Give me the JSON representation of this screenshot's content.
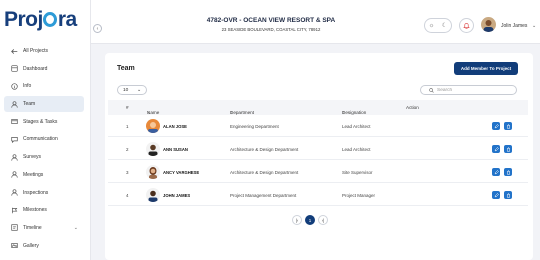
{
  "brand": {
    "logo_pre": "Proj",
    "logo_post": "ra"
  },
  "sidebar": {
    "items": [
      {
        "label": "All Projects",
        "icon": "arrow-left-icon"
      },
      {
        "label": "Dashboard",
        "icon": "dashboard-icon"
      },
      {
        "label": "Info",
        "icon": "info-icon"
      },
      {
        "label": "Team",
        "icon": "user-icon",
        "active": true
      },
      {
        "label": "Stages & Tasks",
        "icon": "tasks-icon"
      },
      {
        "label": "Communication",
        "icon": "chat-icon"
      },
      {
        "label": "Surveys",
        "icon": "survey-icon"
      },
      {
        "label": "Meetings",
        "icon": "meeting-icon"
      },
      {
        "label": "Inspections",
        "icon": "inspection-icon"
      },
      {
        "label": "Milestones",
        "icon": "milestone-icon"
      },
      {
        "label": "Timeline",
        "icon": "timeline-icon"
      },
      {
        "label": "Gallery",
        "icon": "gallery-icon"
      }
    ]
  },
  "header": {
    "project_title": "4782-OVR - OCEAN VIEW RESORT & SPA",
    "project_address": "23 SEASIDE BOULEVARD, COASTAL CITY, 78912",
    "user_name": "Jolin James"
  },
  "team": {
    "title": "Team",
    "add_button": "Add Member To Project",
    "page_size": "10",
    "search_placeholder": "Search",
    "columns": {
      "num": "#",
      "name": "Name",
      "department": "Department",
      "designation": "Designation",
      "action": "Action"
    },
    "rows": [
      {
        "num": "1",
        "name": "ALAN JOSE",
        "department": "Engineering Department",
        "designation": "Lead Architect"
      },
      {
        "num": "2",
        "name": "ANN SUSAN",
        "department": "Architecture & Design Department",
        "designation": "Lead Architect"
      },
      {
        "num": "3",
        "name": "ANCY VARGHESE",
        "department": "Architecture & Design Department",
        "designation": "Site Supervisor"
      },
      {
        "num": "4",
        "name": "JOHN JAMES",
        "department": "Project Management Department",
        "designation": "Project Manager"
      }
    ],
    "pagination": {
      "current": "1"
    }
  },
  "colors": {
    "brand_navy": "#123d7a",
    "action_blue": "#2273c9",
    "logo_accent": "#2d9bd7"
  }
}
